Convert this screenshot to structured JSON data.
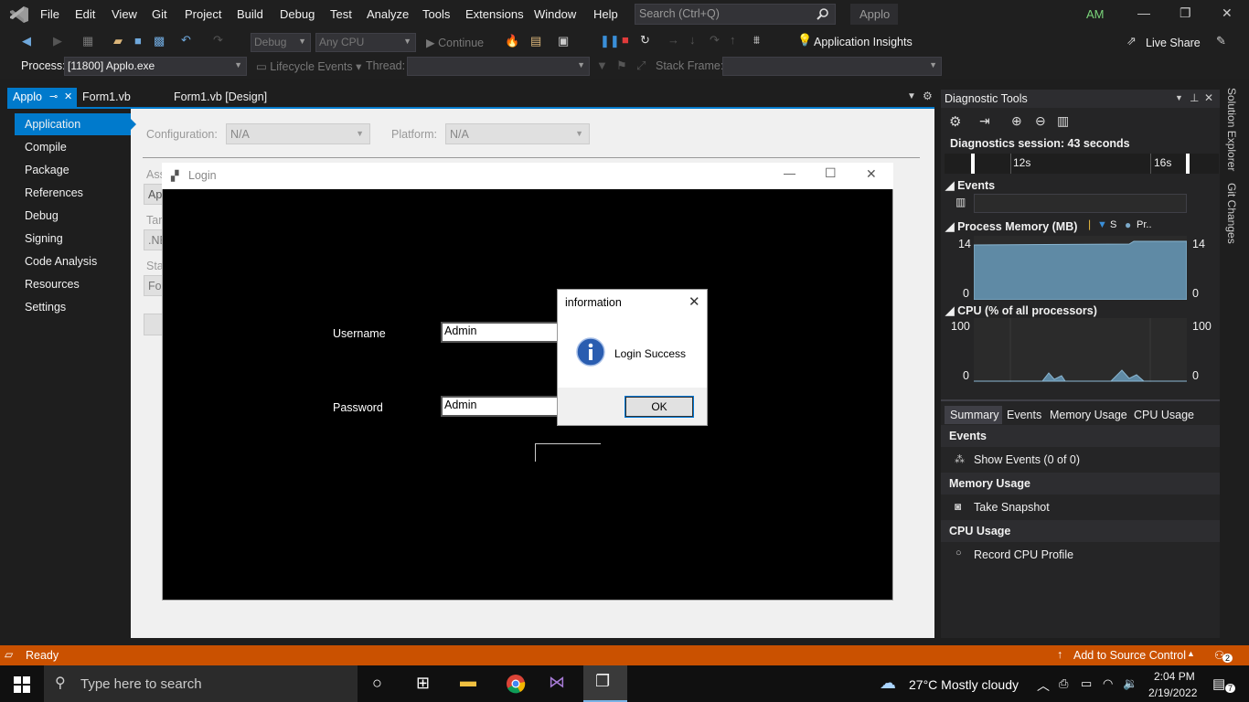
{
  "menu": {
    "items": [
      "File",
      "Edit",
      "View",
      "Git",
      "Project",
      "Build",
      "Debug",
      "Test",
      "Analyze",
      "Tools",
      "Extensions",
      "Window",
      "Help"
    ],
    "search_placeholder": "Search (Ctrl+Q)",
    "app_name": "Applo",
    "avatar": "AM"
  },
  "toolbar": {
    "config": "Debug",
    "platform": "Any CPU",
    "continue_label": "Continue",
    "app_insights": "Application Insights",
    "live_share": "Live Share",
    "process_label": "Process:",
    "process_value": "[11800] Applo.exe",
    "lifecycle": "Lifecycle Events",
    "thread_label": "Thread:",
    "stack_frame_label": "Stack Frame:"
  },
  "tabs": [
    {
      "label": "Applo"
    },
    {
      "label": "Form1.vb"
    },
    {
      "label": "Form1.vb [Design]"
    }
  ],
  "propnav": [
    "Application",
    "Compile",
    "Package",
    "References",
    "Debug",
    "Signing",
    "Code Analysis",
    "Resources",
    "Settings"
  ],
  "props": {
    "config_label": "Configuration:",
    "config_value": "N/A",
    "platform_label": "Platform:",
    "platform_value": "N/A",
    "partial_ass": "Ass",
    "partial_ap": "Ap",
    "partial_tar": "Tar",
    "partial_ne": ".NE",
    "partial_sta": "Sta",
    "partial_fo": "Fo"
  },
  "login": {
    "title": "Login",
    "username_label": "Username",
    "username_value": "Admin",
    "password_label": "Password",
    "password_value": "Admin"
  },
  "msgbox": {
    "title": "information",
    "message": "Login Success",
    "ok": "OK"
  },
  "diag": {
    "title": "Diagnostic Tools",
    "session": "Diagnostics session: 43 seconds",
    "t1": "12s",
    "t2": "16s",
    "events": "Events",
    "memory_title": "Process Memory (MB)",
    "mem_legend_s": "S",
    "mem_legend_pr": "Pr..",
    "mem_max": "14",
    "mem_min": "0",
    "cpu_title": "CPU (% of all processors)",
    "cpu_max": "100",
    "cpu_min": "0",
    "tabs": [
      "Summary",
      "Events",
      "Memory Usage",
      "CPU Usage"
    ],
    "sec_events": "Events",
    "show_events": "Show Events (0 of 0)",
    "sec_memory": "Memory Usage",
    "take_snapshot": "Take Snapshot",
    "sec_cpu": "CPU Usage",
    "record_cpu": "Record CPU Profile",
    "side_solution": "Solution Explorer",
    "side_git": "Git Changes"
  },
  "status": {
    "ready": "Ready",
    "source_control": "Add to Source Control",
    "notif_count": "2"
  },
  "taskbar": {
    "search_placeholder": "Type here to search",
    "weather": "27°C  Mostly cloudy",
    "time": "2:04 PM",
    "date": "2/19/2022",
    "notif": "7"
  }
}
